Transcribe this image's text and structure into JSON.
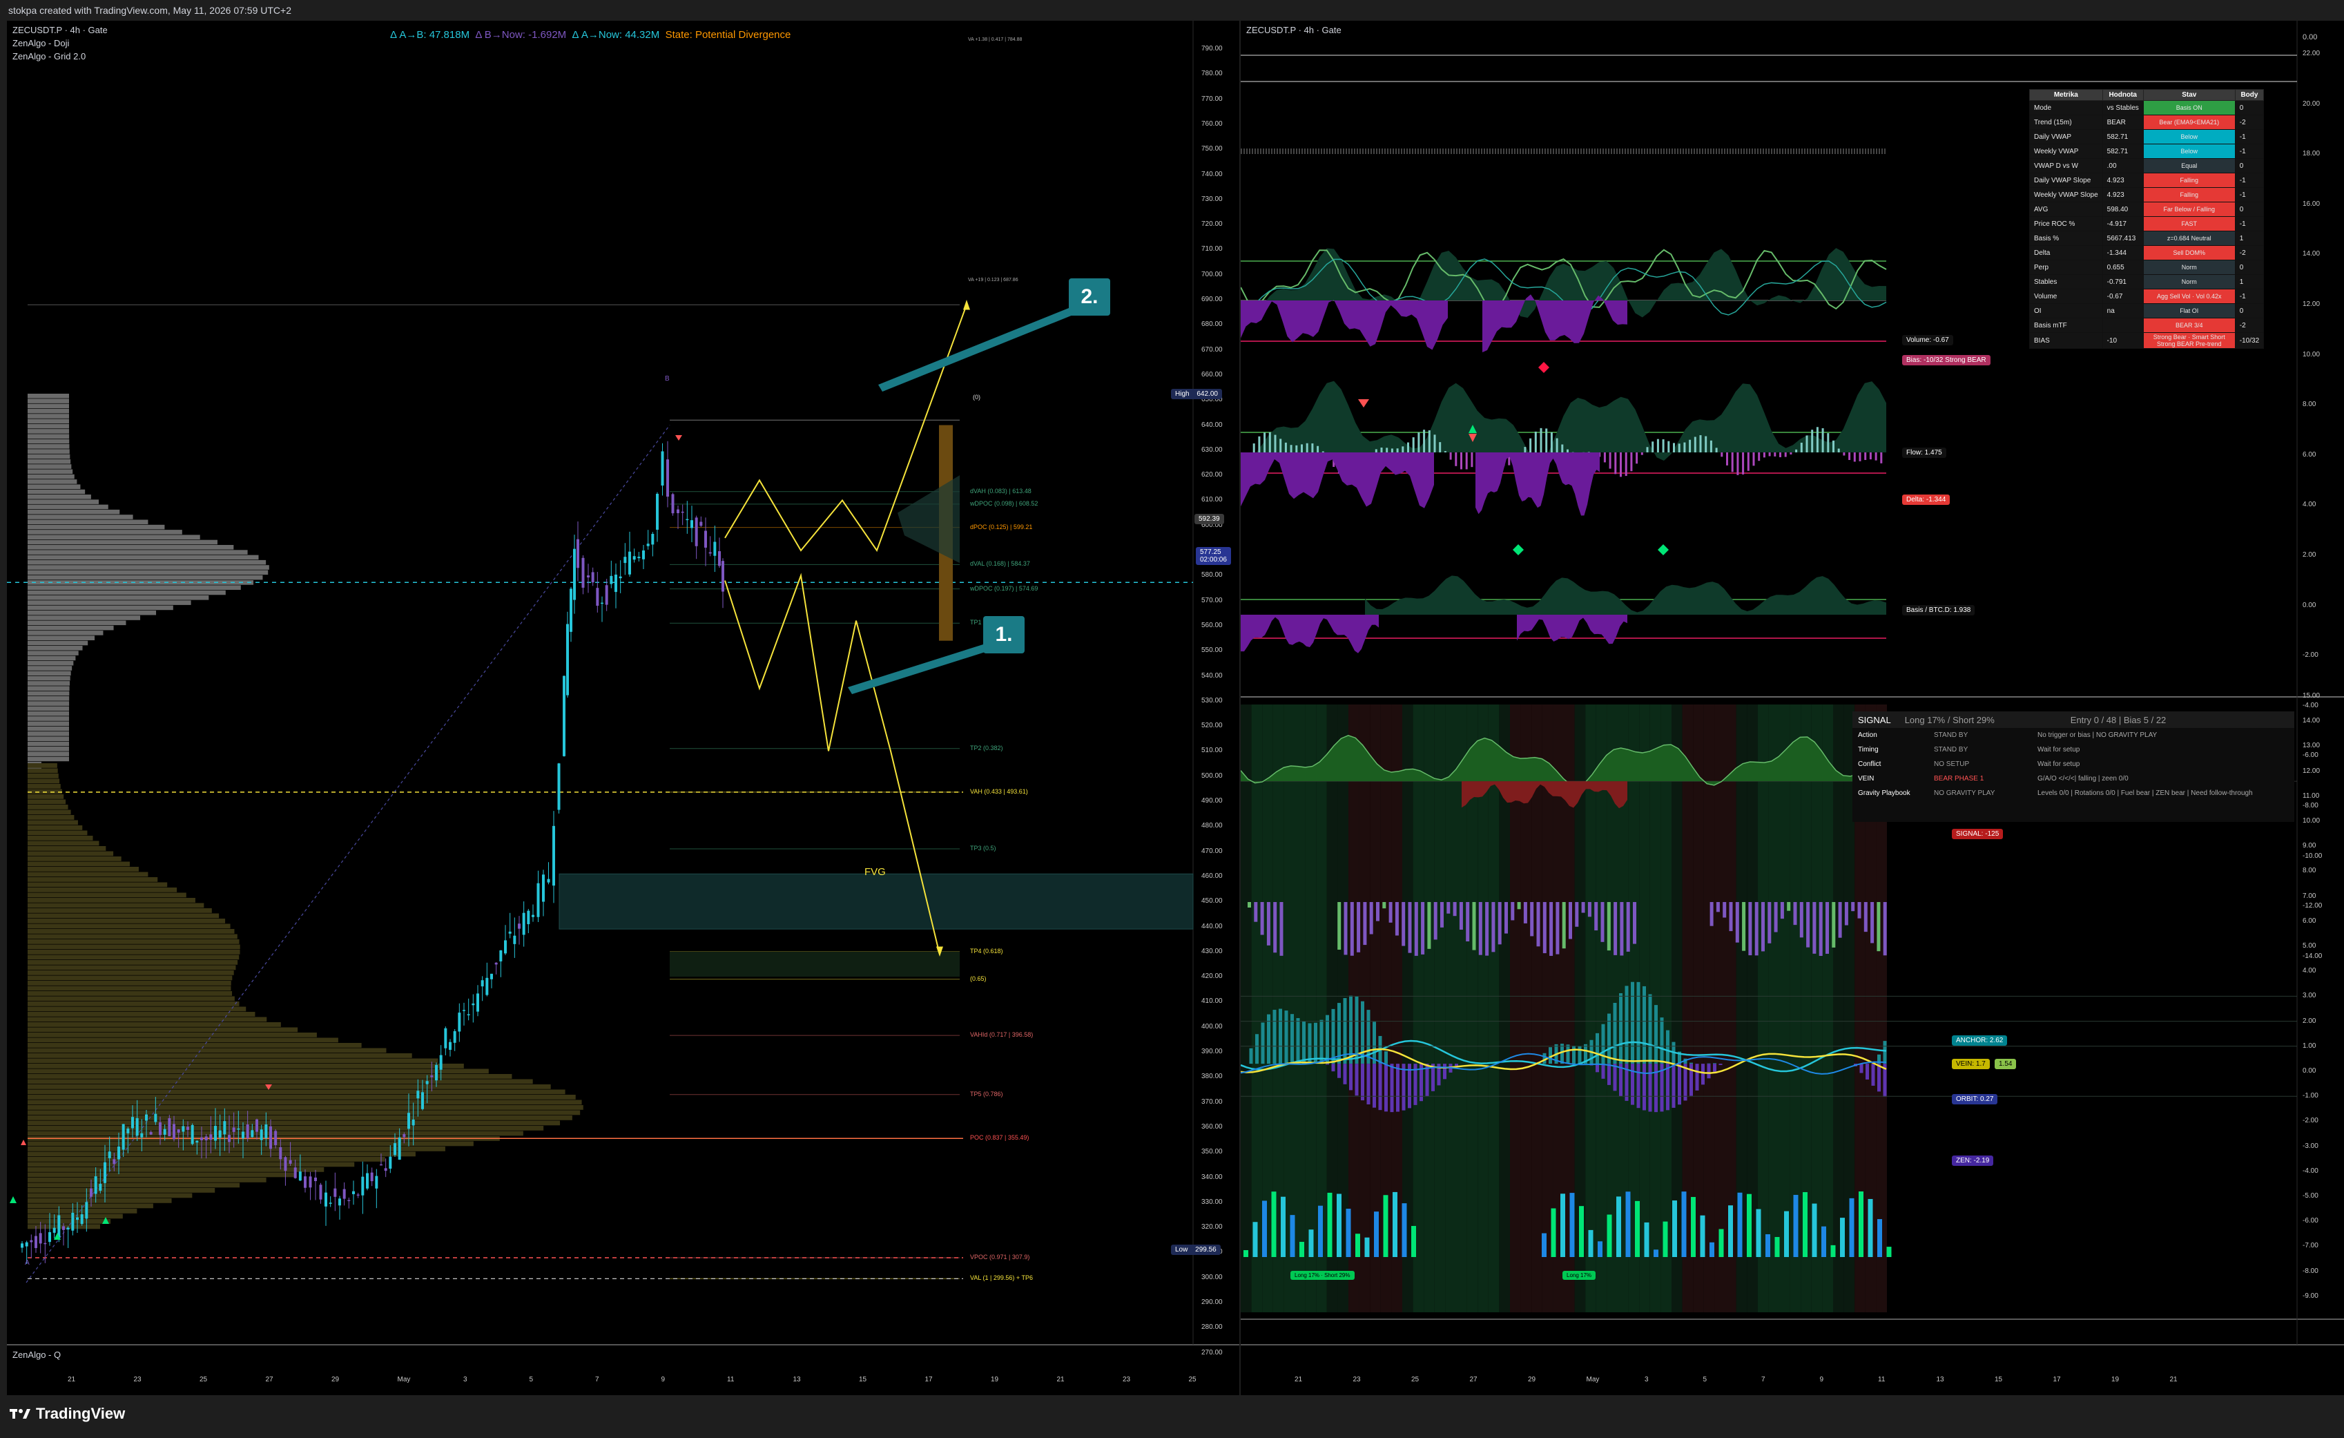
{
  "header": {
    "credit": "stokpa created with TradingView.com, May 11, 2026 07:59 UTC+2"
  },
  "colors": {
    "bull": "#26c6da",
    "bear": "#7e57c2",
    "fvg": "#0f2a2a",
    "accent": "#f5e33b",
    "callout": "#1a7b86"
  },
  "left": {
    "title": "ZECUSDT.P · 4h · Gate",
    "indicators": [
      "ZenAlgo - Doji",
      "ZenAlgo - Grid 2.0"
    ],
    "legend": {
      "b": "Δ A→B: 47.818M",
      "now_b": "Δ B→Now: -1.692M",
      "now_a": "Δ A→Now: 44.32M",
      "state": "State: Potential Divergence"
    },
    "y_ticks": [
      "790.00",
      "780.00",
      "770.00",
      "760.00",
      "750.00",
      "740.00",
      "730.00",
      "720.00",
      "710.00",
      "700.00",
      "690.00",
      "680.00",
      "670.00",
      "660.00",
      "650.00",
      "640.00",
      "630.00",
      "620.00",
      "610.00",
      "600.00",
      "590.00",
      "580.00",
      "570.00",
      "560.00",
      "550.00",
      "540.00",
      "530.00",
      "520.00",
      "510.00",
      "500.00",
      "490.00",
      "480.00",
      "470.00",
      "460.00",
      "450.00",
      "440.00",
      "430.00",
      "420.00",
      "410.00",
      "400.00",
      "390.00",
      "380.00",
      "370.00",
      "360.00",
      "350.00",
      "340.00",
      "330.00",
      "320.00",
      "310.00",
      "300.00",
      "290.00",
      "280.00",
      "270.00"
    ],
    "x_ticks": [
      "21",
      "23",
      "25",
      "27",
      "29",
      "May",
      "3",
      "5",
      "7",
      "9",
      "11",
      "13",
      "15",
      "17",
      "19",
      "21",
      "23",
      "25"
    ],
    "high_tag": {
      "label": "High",
      "value": "642.00"
    },
    "low_tag": {
      "label": "Low",
      "value": "299.56"
    },
    "price_tag": {
      "value": "577.25",
      "sub": "02:00:06"
    },
    "alt_tag": "592.39",
    "levels": [
      {
        "text": "dVAH (0.083) | 613.48",
        "color": "#3fa37a",
        "price": 613.48
      },
      {
        "text": "wDPOC (0.098) | 608.52",
        "color": "#3fa37a",
        "price": 608.5
      },
      {
        "text": "dPOC (0.125) | 599.21",
        "color": "#ff9800",
        "price": 599.21
      },
      {
        "text": "dVAL (0.168) | 584.37",
        "color": "#3fa37a",
        "price": 584.37
      },
      {
        "text": "wDPOC (0.197) | 574.69",
        "color": "#3fa37a",
        "price": 574.69
      },
      {
        "text": "TP1 (0.236)",
        "color": "#3fa37a",
        "price": 561
      },
      {
        "text": "TP2 (0.382)",
        "color": "#3fa37a",
        "price": 511
      },
      {
        "text": "VAH (0.433 | 493.61)",
        "color": "#f5e33b",
        "price": 493.61
      },
      {
        "text": "TP3 (0.5)",
        "color": "#3fa37a",
        "price": 471
      },
      {
        "text": "TP4 (0.618)",
        "color": "#f5e33b",
        "price": 430
      },
      {
        "text": "(0.65)",
        "color": "#f5e33b",
        "price": 419
      },
      {
        "text": "VAHId (0.717 | 396.58)",
        "color": "#e06666",
        "price": 396.58
      },
      {
        "text": "TP5 (0.786)",
        "color": "#e06666",
        "price": 373
      },
      {
        "text": "POC (0.837 | 355.49)",
        "color": "#ff5252",
        "price": 355.49
      },
      {
        "text": "VPOC (0.971 | 307.9)",
        "color": "#e06666",
        "price": 307.9
      },
      {
        "text": "VAL (1 | 299.56) + TP6",
        "color": "#f5e33b",
        "price": 299.56
      }
    ],
    "top_small": "(0)",
    "top_line": "VA +19 | 0.123 | 687.86",
    "top_line2": "VA +1.38 | 0.417 | 784.88",
    "fvg": "FVG",
    "label_a": "A",
    "label_b": "B",
    "callout1": "1.",
    "callout2": "2.",
    "footer": "ZenAlgo - Q"
  },
  "right": {
    "title": "ZECUSDT.P · 4h · Gate",
    "y_ticks_top": [
      "22.00",
      "20.00",
      "18.00",
      "16.00",
      "14.00",
      "12.00",
      "10.00",
      "8.00",
      "6.00",
      "4.00",
      "2.00",
      "0.00",
      "-2.00",
      "-4.00",
      "-6.00",
      "-8.00",
      "-10.00",
      "-12.00",
      "-14.00"
    ],
    "y_ticks_bottom": [
      "15.00",
      "14.00",
      "13.00",
      "12.00",
      "11.00",
      "10.00",
      "9.00",
      "8.00",
      "7.00",
      "6.00",
      "5.00",
      "4.00",
      "3.00",
      "2.00",
      "1.00",
      "0.00",
      "-1.00",
      "-2.00",
      "-3.00",
      "-4.00",
      "-5.00",
      "-6.00",
      "-7.00",
      "-8.00",
      "-9.00"
    ],
    "y_top_zero": "0.00",
    "x_ticks": [
      "21",
      "23",
      "25",
      "27",
      "29",
      "May",
      "3",
      "5",
      "7",
      "9",
      "11",
      "13",
      "15",
      "17",
      "19",
      "21"
    ],
    "tags": {
      "volume": "Volume: -0.67",
      "bias": "Bias: -10/32 Strong BEAR",
      "flow": "Flow: 1.475",
      "delta": "Delta: -1.344",
      "basis": "Basis / BTC.D: 1.938",
      "signal": "SIGNAL: -125",
      "anchor": "ANCHOR: 2.62",
      "vein": "VEIN: 1.7",
      "vein2": "1.54",
      "orbit": "ORBIT: 0.27",
      "zen": "ZEN: -2.19",
      "long1": "Long 17% · Short 29%",
      "long2": "Long 17%"
    },
    "table": {
      "headers": [
        "Metrika",
        "Hodnota",
        "Stav",
        "Body"
      ],
      "rows": [
        {
          "m": "Mode",
          "v": "vs Stables",
          "s": "Basis ON",
          "b": "0",
          "c": "#2e9e44"
        },
        {
          "m": "Trend (15m)",
          "v": "BEAR",
          "s": "Bear (EMA9<EMA21)",
          "b": "-2",
          "c": "#e53935"
        },
        {
          "m": "Daily VWAP",
          "v": "582.71",
          "s": "Below",
          "b": "-1",
          "c": "#00acc1"
        },
        {
          "m": "Weekly VWAP",
          "v": "582.71",
          "s": "Below",
          "b": "-1",
          "c": "#00acc1"
        },
        {
          "m": "VWAP D vs W",
          "v": ".00",
          "s": "Equal",
          "b": "0",
          "c": "#263238"
        },
        {
          "m": "Daily VWAP Slope",
          "v": "4.923",
          "s": "Falling",
          "b": "-1",
          "c": "#e53935"
        },
        {
          "m": "Weekly VWAP Slope",
          "v": "4.923",
          "s": "Falling",
          "b": "-1",
          "c": "#e53935"
        },
        {
          "m": "AVG",
          "v": "598.40",
          "s": "Far Below / Falling",
          "b": "0",
          "c": "#e53935"
        },
        {
          "m": "Price ROC %",
          "v": "-4.917",
          "s": "FAST",
          "b": "-1",
          "c": "#e53935"
        },
        {
          "m": "Basis %",
          "v": "5667.413",
          "s": "z=0.684 Neutral",
          "b": "1",
          "c": "#263238"
        },
        {
          "m": "Delta",
          "v": "-1.344",
          "s": "Sell DOM%",
          "b": "-2",
          "c": "#e53935"
        },
        {
          "m": "Perp",
          "v": "0.655",
          "s": "Norm",
          "b": "0",
          "c": "#263238"
        },
        {
          "m": "Stables",
          "v": "-0.791",
          "s": "Norm",
          "b": "1",
          "c": "#263238"
        },
        {
          "m": "Volume",
          "v": "-0.67",
          "s": "Agg Sell Vol · Vol 0.42x",
          "b": "-1",
          "c": "#e53935"
        },
        {
          "m": "OI",
          "v": "na",
          "s": "Flat OI",
          "b": "0",
          "c": "#263238"
        },
        {
          "m": "Basis mTF",
          "v": "",
          "s": "BEAR 3/4",
          "b": "-2",
          "c": "#e53935"
        },
        {
          "m": "BIAS",
          "v": "-10",
          "s": "Strong Bear · Smart Short Strong BEAR Pre-trend",
          "b": "-10/32",
          "c": "#e53935"
        }
      ]
    },
    "signal_panel": {
      "title": "SIGNAL",
      "ls": "Long 17% / Short 29%",
      "entry": "Entry 0 / 48 | Bias 5 / 22",
      "rows": [
        {
          "k": "Action",
          "v": "STAND BY",
          "d": "No trigger or bias | NO GRAVITY PLAY",
          "vc": "#9e9e9e"
        },
        {
          "k": "Timing",
          "v": "STAND BY",
          "d": "Wait for setup",
          "vc": "#9e9e9e"
        },
        {
          "k": "Conflict",
          "v": "NO SETUP",
          "d": "Wait for setup",
          "vc": "#9e9e9e"
        },
        {
          "k": "VEIN",
          "v": "BEAR PHASE 1",
          "d": "G/A/O </</<| falling | zeen 0/0",
          "vc": "#ff5252"
        },
        {
          "k": "Gravity Playbook",
          "v": "NO GRAVITY PLAY",
          "d": "Levels 0/0 | Rotations 0/0 | Fuel bear | ZEN bear | Need follow-through",
          "vc": "#9e9e9e"
        }
      ]
    }
  }
}
